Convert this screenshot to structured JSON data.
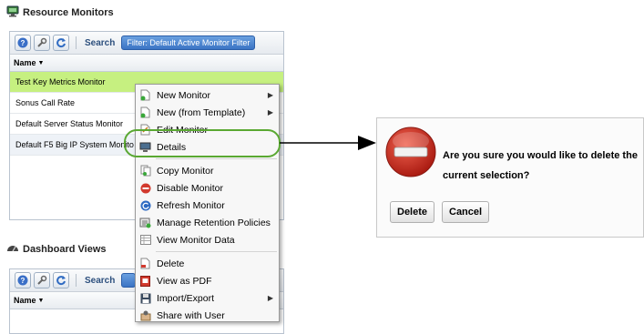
{
  "resource_monitors": {
    "title": "Resource Monitors",
    "toolbar": {
      "help_icon": "help-icon",
      "wrench_icon": "wrench-icon",
      "refresh_icon": "refresh-icon",
      "search_label": "Search",
      "filter_label": "Filter: Default Active Monitor Filter"
    },
    "column_header": "Name",
    "rows": [
      "Test Key Metrics Monitor",
      "Sonus Call Rate",
      "Default Server Status Monitor",
      "Default F5 Big IP System Monito"
    ]
  },
  "context_menu": {
    "items": [
      {
        "label": "New Monitor",
        "icon": "new-doc-icon",
        "submenu": true
      },
      {
        "label": "New (from Template)",
        "icon": "new-doc-icon",
        "submenu": true
      },
      {
        "label": "Edit Monitor",
        "icon": "edit-doc-icon",
        "submenu": false
      },
      {
        "label": "Details",
        "icon": "monitor-icon",
        "submenu": false
      },
      {
        "label": "Copy Monitor",
        "icon": "copy-icon",
        "submenu": false
      },
      {
        "label": "Disable Monitor",
        "icon": "disable-icon",
        "submenu": false
      },
      {
        "label": "Refresh Monitor",
        "icon": "refresh-icon",
        "submenu": false
      },
      {
        "label": "Manage Retention Policies",
        "icon": "retention-icon",
        "submenu": false
      },
      {
        "label": "View Monitor Data",
        "icon": "table-icon",
        "submenu": false
      },
      {
        "label": "Delete",
        "icon": "delete-doc-icon",
        "submenu": false
      },
      {
        "label": "View as PDF",
        "icon": "pdf-icon",
        "submenu": false
      },
      {
        "label": "Import/Export",
        "icon": "floppy-icon",
        "submenu": true
      },
      {
        "label": "Share with User",
        "icon": "share-icon",
        "submenu": false
      }
    ]
  },
  "dashboard_views": {
    "title": "Dashboard Views",
    "search_label": "Search",
    "column_header": "Name"
  },
  "dialog": {
    "message_line1": "Are you sure you would like to delete the",
    "message_line2": "current selection?",
    "delete_label": "Delete",
    "cancel_label": "Cancel"
  },
  "colors": {
    "selected_row": "#c6f080",
    "callout": "#5aa832",
    "filter_pill": "#3b74c4",
    "delete_sign": "#c8281e"
  }
}
